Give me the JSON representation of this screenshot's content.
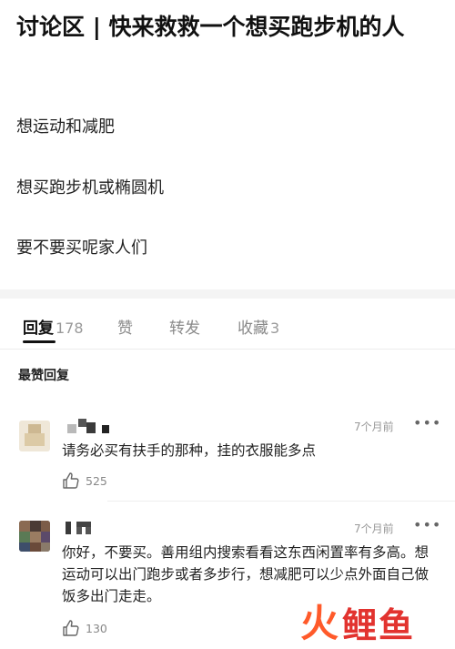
{
  "post": {
    "title": "讨论区 | 快来救救一个想买跑步机的人",
    "lines": [
      "想运动和减肥",
      "想买跑步机或椭圆机",
      "要不要买呢家人们"
    ]
  },
  "tabs": [
    {
      "label": "回复",
      "count": "178",
      "active": true
    },
    {
      "label": "赞",
      "count": ""
    },
    {
      "label": "转发",
      "count": ""
    },
    {
      "label": "收藏",
      "count": "3"
    }
  ],
  "sort_label": "最赞回复",
  "comments": [
    {
      "time": "7个月前",
      "more": "•••",
      "text": "请务必买有扶手的那种，挂的衣服能多点",
      "likes": "525"
    },
    {
      "time": "7个月前",
      "more": "•••",
      "text": "你好，不要买。善用组内搜索看看这东西闲置率有多高。想运动可以出门跑步或者多步行，想减肥可以少点外面自己做饭多出门走走。",
      "likes": "130"
    }
  ],
  "watermark": {
    "fire": "火",
    "rest": "鲤鱼"
  },
  "colors": {
    "accent": "#111111",
    "muted": "#999999",
    "watermark": "#e2332f"
  }
}
